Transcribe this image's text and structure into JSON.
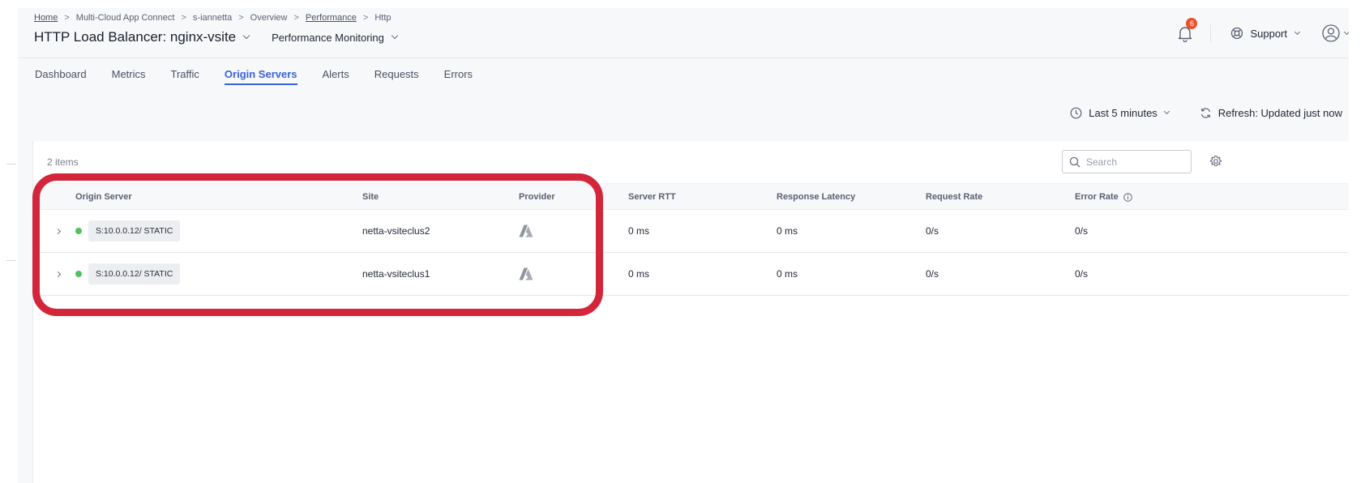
{
  "breadcrumb": [
    "Home",
    "Multi-Cloud App Connect",
    "s-iannetta",
    "Overview",
    "Performance",
    "Http"
  ],
  "header": {
    "title": "HTTP Load Balancer: nginx-vsite",
    "monitor_select": "Performance Monitoring",
    "notifications_count": "6",
    "support_label": "Support"
  },
  "tabs": [
    {
      "label": "Dashboard",
      "active": false
    },
    {
      "label": "Metrics",
      "active": false
    },
    {
      "label": "Traffic",
      "active": false
    },
    {
      "label": "Origin Servers",
      "active": true
    },
    {
      "label": "Alerts",
      "active": false
    },
    {
      "label": "Requests",
      "active": false
    },
    {
      "label": "Errors",
      "active": false
    }
  ],
  "toolbar": {
    "time_range": "Last 5 minutes",
    "refresh": "Refresh: Updated just now"
  },
  "panel": {
    "items_count": "2 items",
    "search_placeholder": "Search"
  },
  "table": {
    "columns": [
      "Origin Server",
      "Site",
      "Provider",
      "Server RTT",
      "Response Latency",
      "Request Rate",
      "Error Rate"
    ],
    "rows": [
      {
        "origin": "S:10.0.0.12/ STATIC",
        "site": "netta-vsiteclus2",
        "provider_icon": "azure-icon",
        "rtt": "0 ms",
        "latency": "0 ms",
        "request_rate": "0/s",
        "error_rate": "0/s"
      },
      {
        "origin": "S:10.0.0.12/ STATIC",
        "site": "netta-vsiteclus1",
        "provider_icon": "azure-icon",
        "rtt": "0 ms",
        "latency": "0 ms",
        "request_rate": "0/s",
        "error_rate": "0/s"
      }
    ]
  },
  "colors": {
    "accent": "#3b63d6",
    "status_ok": "#4fc45c",
    "badge": "#e5532a",
    "highlight": "#d3263b"
  }
}
